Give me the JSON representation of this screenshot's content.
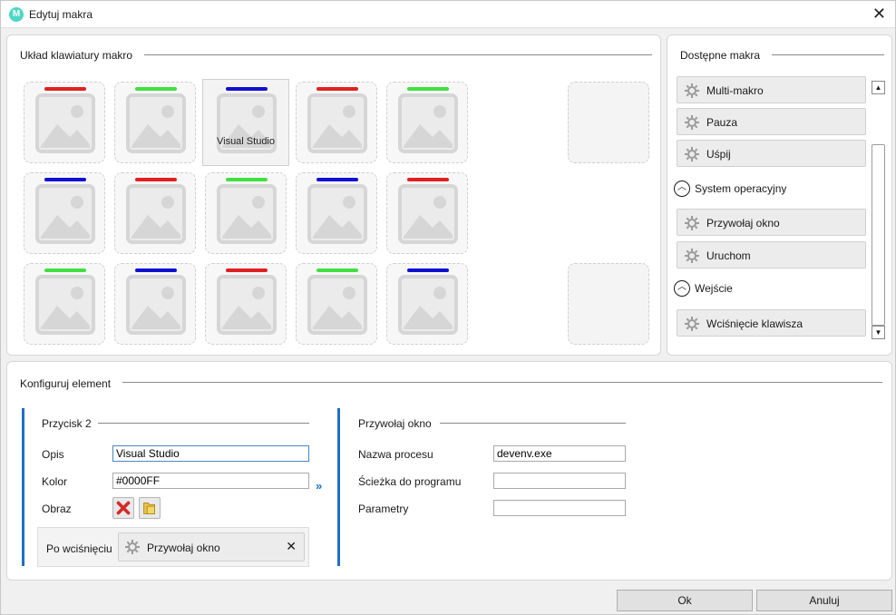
{
  "window": {
    "title": "Edytuj makra",
    "app_icon_letter": "M"
  },
  "layout_section": {
    "title": "Układ klawiatury makro",
    "keys": [
      {
        "color": "#e02020",
        "label": ""
      },
      {
        "color": "#40e040",
        "label": ""
      },
      {
        "color": "#1010d0",
        "label": "Visual Studio"
      },
      {
        "color": "#e02020",
        "label": ""
      },
      {
        "color": "#40e040",
        "label": ""
      },
      {
        "color": "#1010d0",
        "label": ""
      },
      {
        "color": "#e02020",
        "label": ""
      },
      {
        "color": "#40e040",
        "label": ""
      },
      {
        "color": "#1010d0",
        "label": ""
      },
      {
        "color": "#e02020",
        "label": ""
      },
      {
        "color": "#40e040",
        "label": ""
      },
      {
        "color": "#1010d0",
        "label": ""
      },
      {
        "color": "#e02020",
        "label": ""
      },
      {
        "color": "#40e040",
        "label": ""
      },
      {
        "color": "#1010d0",
        "label": ""
      }
    ]
  },
  "macros_section": {
    "title": "Dostępne makra",
    "items": [
      {
        "label": "Multi-makro",
        "icon": "gear-icon"
      },
      {
        "label": "Pauza",
        "icon": "gear-icon"
      },
      {
        "label": "Uśpij",
        "icon": "gear-icon"
      }
    ],
    "categories": [
      {
        "label": "System operacyjny",
        "items": [
          {
            "label": "Przywołaj okno",
            "icon": "gear-icon"
          },
          {
            "label": "Uruchom",
            "icon": "gear-icon"
          }
        ]
      },
      {
        "label": "Wejście",
        "items": [
          {
            "label": "Wciśnięcie klawisza",
            "icon": "gear-icon"
          }
        ]
      }
    ]
  },
  "config_section": {
    "title": "Konfiguruj element",
    "button_panel": {
      "title": "Przycisk 2",
      "desc_label": "Opis",
      "desc_value": "Visual Studio",
      "color_label": "Kolor",
      "color_value": "#0000FF",
      "image_label": "Obraz",
      "after_press_label": "Po wciśnięciu",
      "after_press_action": "Przywołaj okno"
    },
    "action_panel": {
      "title": "Przywołaj okno",
      "process_label": "Nazwa procesu",
      "process_value": "devenv.exe",
      "path_label": "Ścieżka do programu",
      "path_value": "",
      "params_label": "Parametry",
      "params_value": ""
    }
  },
  "footer": {
    "ok_label": "Ok",
    "cancel_label": "Anuluj"
  },
  "colors": {
    "accent": "#1f6fc4",
    "key_red": "#e02020",
    "key_green": "#40e040",
    "key_blue": "#1010d0"
  }
}
